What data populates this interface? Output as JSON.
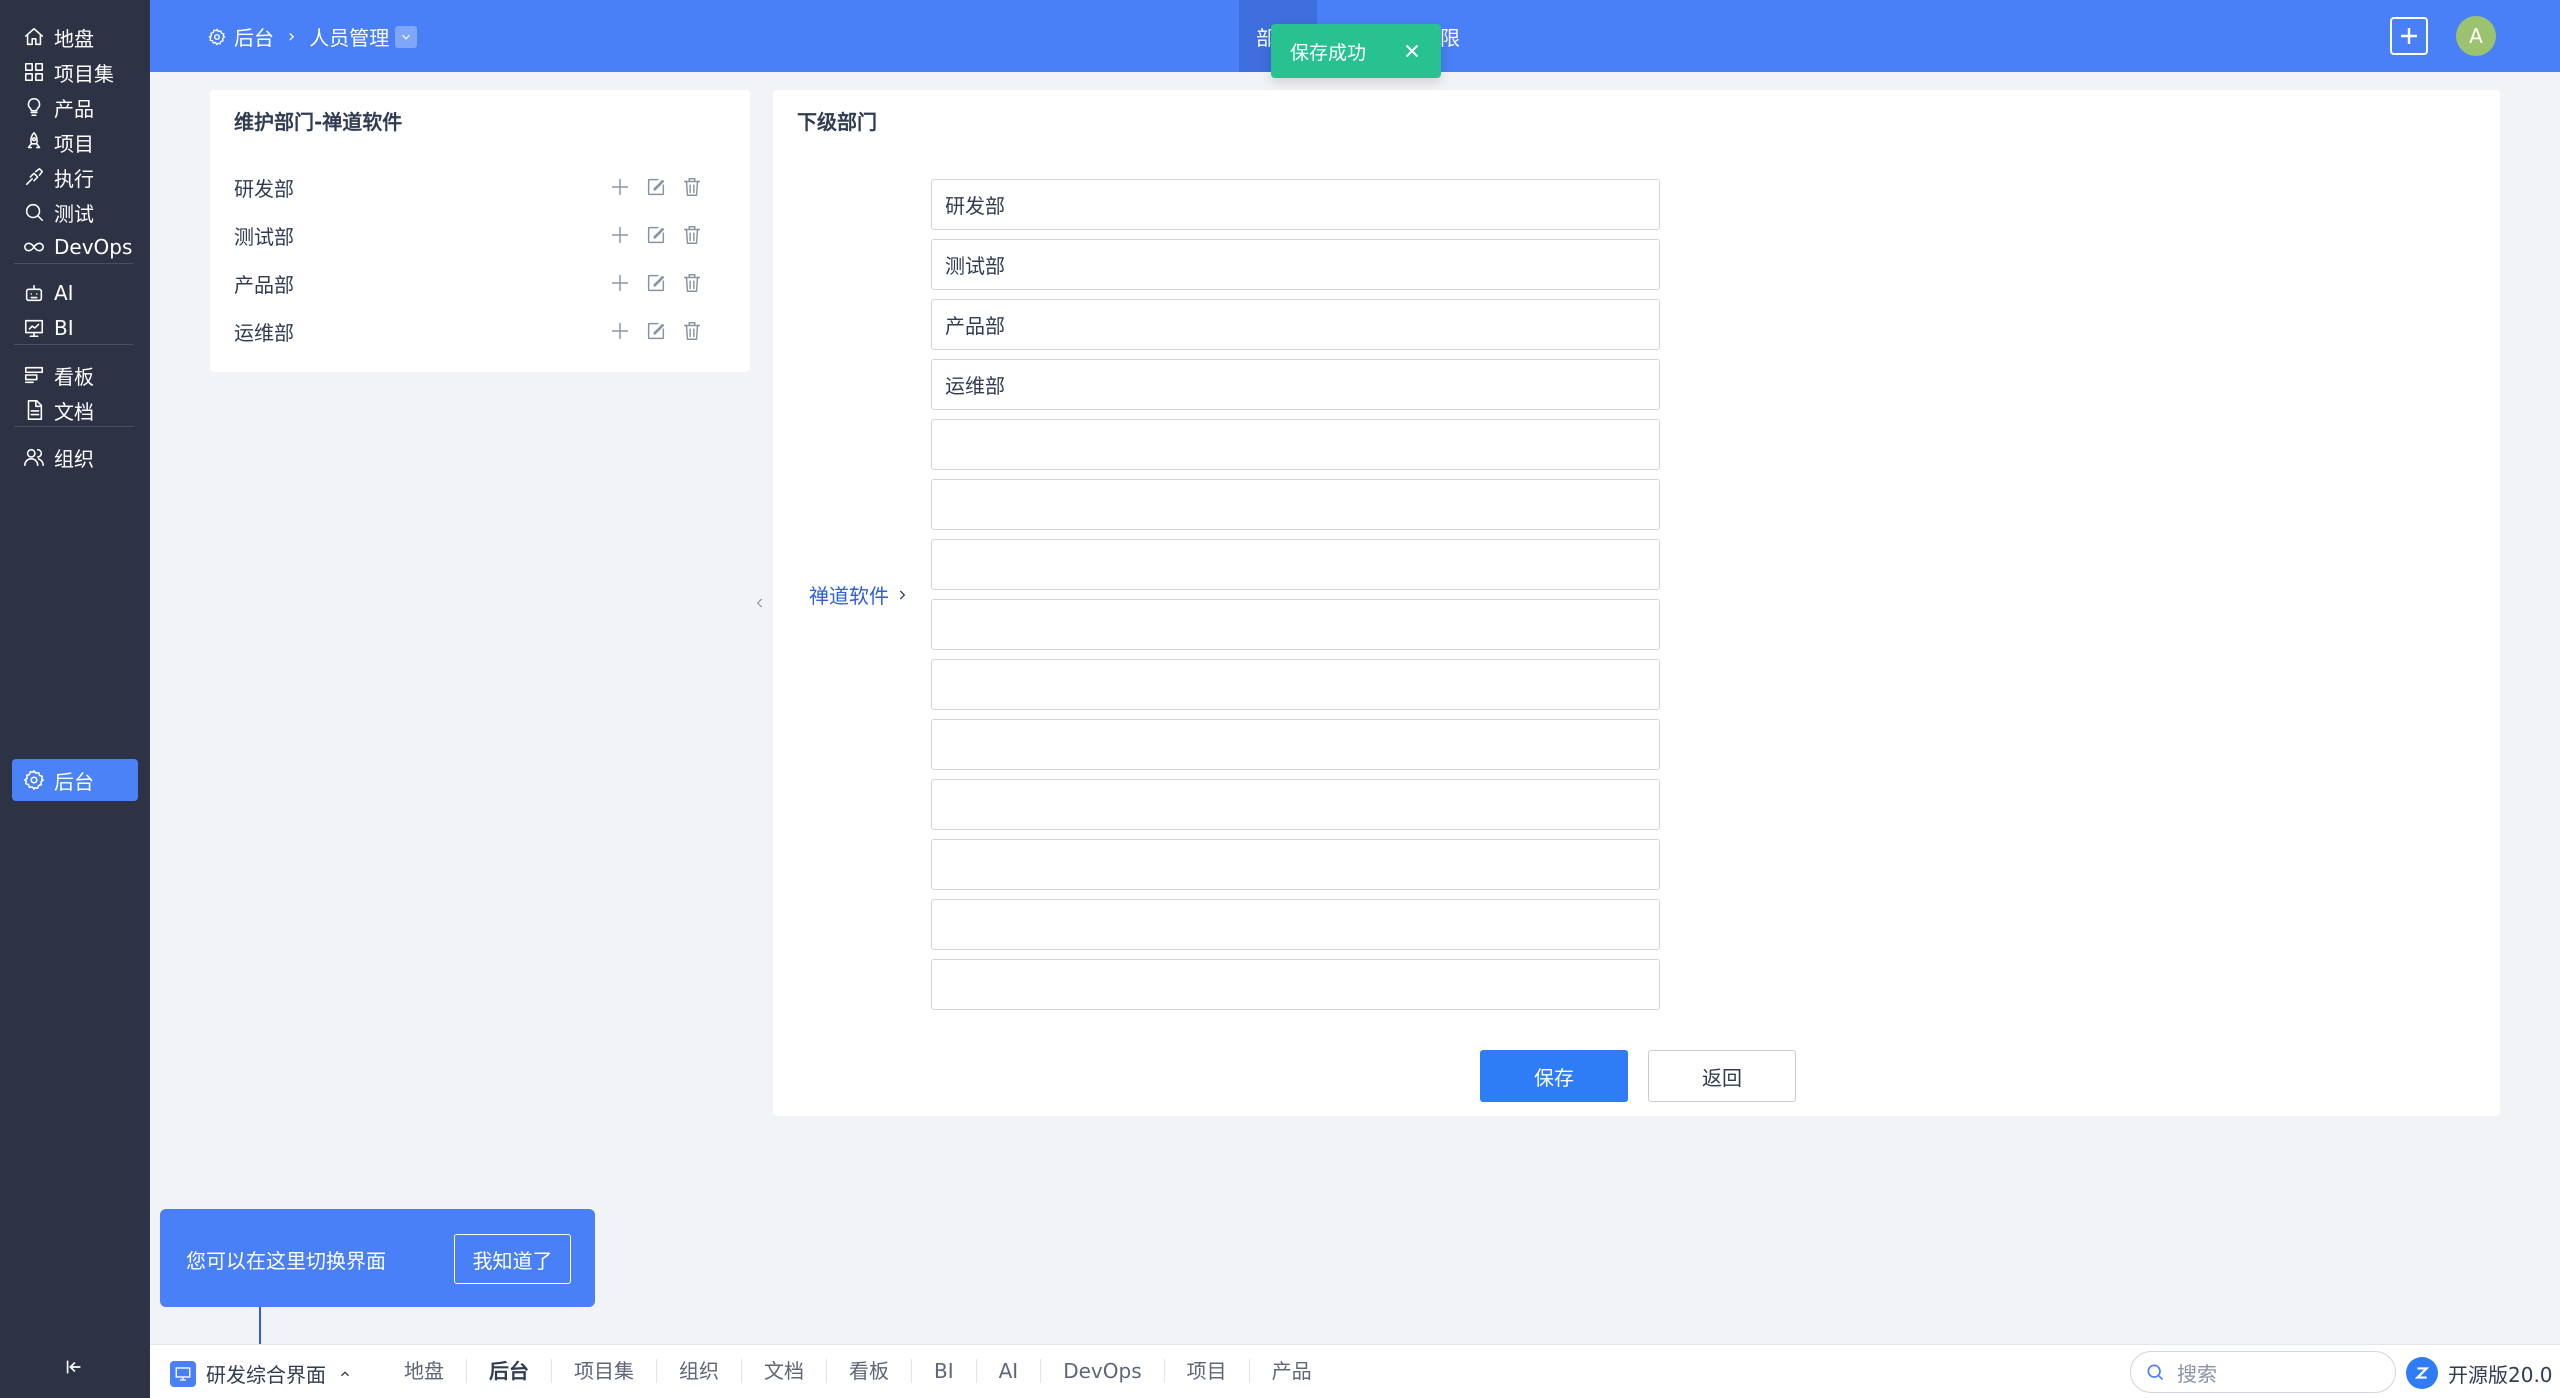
{
  "sidebar": {
    "items": [
      {
        "label": "地盘",
        "icon": "home-icon"
      },
      {
        "label": "项目集",
        "icon": "grid-icon"
      },
      {
        "label": "产品",
        "icon": "lightbulb-icon"
      },
      {
        "label": "项目",
        "icon": "rocket-icon"
      },
      {
        "label": "执行",
        "icon": "run-icon"
      },
      {
        "label": "测试",
        "icon": "search-icon"
      },
      {
        "label": "DevOps",
        "icon": "infinity-icon"
      },
      {
        "label": "AI",
        "icon": "robot-icon"
      },
      {
        "label": "BI",
        "icon": "chart-board-icon"
      },
      {
        "label": "看板",
        "icon": "kanban-icon"
      },
      {
        "label": "文档",
        "icon": "document-icon"
      },
      {
        "label": "组织",
        "icon": "users-icon"
      },
      {
        "label": "后台",
        "icon": "gear-icon"
      }
    ],
    "active": "后台",
    "collapse_icon": "collapse-icon"
  },
  "header": {
    "breadcrumb": {
      "root": "后台",
      "current": "人员管理"
    },
    "nav_tab_partial_1": "部",
    "nav_tab_partial_2": "限",
    "avatar_letter": "A",
    "color": "#4a80f7"
  },
  "toast": {
    "text": "保存成功",
    "color": "#27c290"
  },
  "left_panel": {
    "title": "维护部门-禅道软件",
    "departments": [
      "研发部",
      "测试部",
      "产品部",
      "运维部"
    ]
  },
  "main_panel": {
    "title": "下级部门",
    "parent_link": "禅道软件",
    "inputs": [
      "研发部",
      "测试部",
      "产品部",
      "运维部",
      "",
      "",
      "",
      "",
      "",
      "",
      "",
      "",
      "",
      ""
    ],
    "save_label": "保存",
    "back_label": "返回"
  },
  "tip": {
    "text": "您可以在这里切换界面",
    "button": "我知道了"
  },
  "bottom_bar": {
    "switcher_label": "研发综合界面",
    "tabs": [
      "地盘",
      "后台",
      "项目集",
      "组织",
      "文档",
      "看板",
      "BI",
      "AI",
      "DevOps",
      "项目",
      "产品"
    ],
    "active_tab": "后台",
    "search_placeholder": "搜索",
    "edition": "开源版20.0"
  }
}
